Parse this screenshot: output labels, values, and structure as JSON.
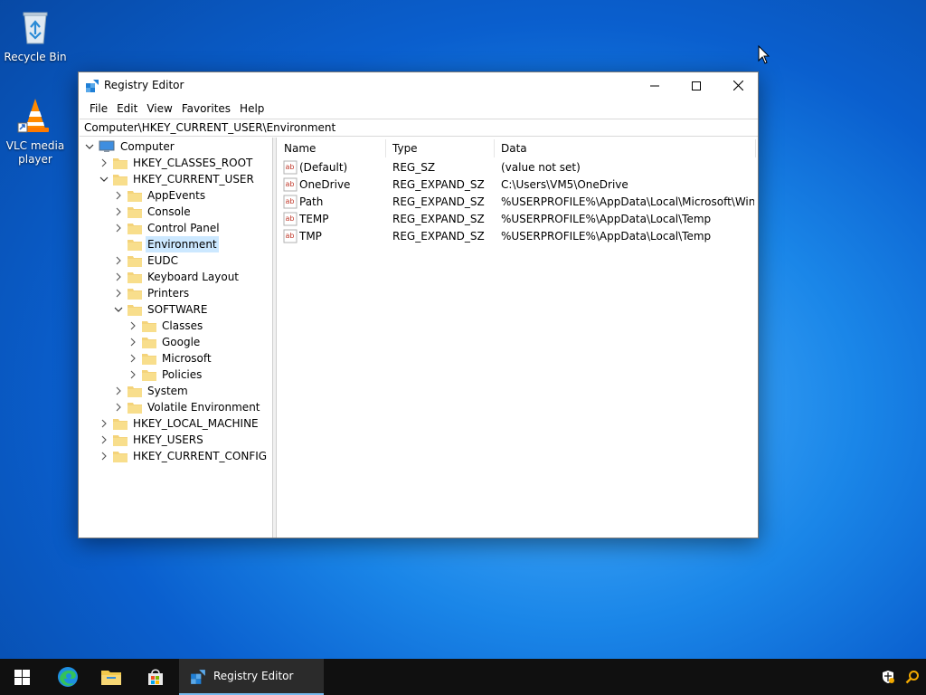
{
  "desktop": {
    "icons": [
      {
        "label": "Recycle Bin",
        "icon": "recycle-bin-icon"
      },
      {
        "label": "VLC media player",
        "icon": "vlc-cone-icon"
      }
    ]
  },
  "window": {
    "title": "Registry Editor",
    "menu": [
      "File",
      "Edit",
      "View",
      "Favorites",
      "Help"
    ],
    "address": "Computer\\HKEY_CURRENT_USER\\Environment"
  },
  "tree": {
    "root": "Computer",
    "items": [
      {
        "label": "HKEY_CLASSES_ROOT",
        "level": 1,
        "expander": "collapsed"
      },
      {
        "label": "HKEY_CURRENT_USER",
        "level": 1,
        "expander": "expanded"
      },
      {
        "label": "AppEvents",
        "level": 2,
        "expander": "collapsed"
      },
      {
        "label": "Console",
        "level": 2,
        "expander": "collapsed"
      },
      {
        "label": "Control Panel",
        "level": 2,
        "expander": "collapsed"
      },
      {
        "label": "Environment",
        "level": 2,
        "expander": "none",
        "selected": true
      },
      {
        "label": "EUDC",
        "level": 2,
        "expander": "collapsed"
      },
      {
        "label": "Keyboard Layout",
        "level": 2,
        "expander": "collapsed"
      },
      {
        "label": "Printers",
        "level": 2,
        "expander": "collapsed"
      },
      {
        "label": "SOFTWARE",
        "level": 2,
        "expander": "expanded"
      },
      {
        "label": "Classes",
        "level": 3,
        "expander": "collapsed"
      },
      {
        "label": "Google",
        "level": 3,
        "expander": "collapsed"
      },
      {
        "label": "Microsoft",
        "level": 3,
        "expander": "collapsed"
      },
      {
        "label": "Policies",
        "level": 3,
        "expander": "collapsed"
      },
      {
        "label": "System",
        "level": 2,
        "expander": "collapsed"
      },
      {
        "label": "Volatile Environment",
        "level": 2,
        "expander": "collapsed"
      },
      {
        "label": "HKEY_LOCAL_MACHINE",
        "level": 1,
        "expander": "collapsed"
      },
      {
        "label": "HKEY_USERS",
        "level": 1,
        "expander": "collapsed"
      },
      {
        "label": "HKEY_CURRENT_CONFIG",
        "level": 1,
        "expander": "collapsed"
      }
    ]
  },
  "list": {
    "columns": [
      "Name",
      "Type",
      "Data"
    ],
    "rows": [
      {
        "name": "(Default)",
        "type": "REG_SZ",
        "data": "(value not set)"
      },
      {
        "name": "OneDrive",
        "type": "REG_EXPAND_SZ",
        "data": "C:\\Users\\VM5\\OneDrive"
      },
      {
        "name": "Path",
        "type": "REG_EXPAND_SZ",
        "data": "%USERPROFILE%\\AppData\\Local\\Microsoft\\Wind..."
      },
      {
        "name": "TEMP",
        "type": "REG_EXPAND_SZ",
        "data": "%USERPROFILE%\\AppData\\Local\\Temp"
      },
      {
        "name": "TMP",
        "type": "REG_EXPAND_SZ",
        "data": "%USERPROFILE%\\AppData\\Local\\Temp"
      }
    ]
  },
  "taskbar": {
    "pinned": [
      "start-icon",
      "edge-icon",
      "file-explorer-icon",
      "store-icon"
    ],
    "active_app": "Registry Editor",
    "tray": [
      "security-shield-icon",
      "search-icon"
    ]
  },
  "colors": {
    "selection": "#cce8ff",
    "taskbar": "#101010",
    "folder": "#f4d37a"
  }
}
